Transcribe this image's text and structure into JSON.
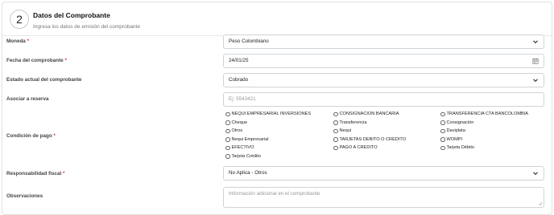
{
  "section": {
    "step": "2",
    "title": "Datos del Comprobante",
    "subtitle": "Ingresa los datos de emisión del comprobante"
  },
  "fields": {
    "moneda": {
      "label": "Moneda",
      "required": "*",
      "value": "Peso Colombiano",
      "icon": "chevron-down-icon"
    },
    "fecha": {
      "label": "Fecha del comprobante",
      "required": "*",
      "value": "24/01/25",
      "icon": "calendar-icon"
    },
    "estado": {
      "label": "Estado actual del comprobante",
      "value": "Cobrado",
      "icon": "chevron-down-icon"
    },
    "reserva": {
      "label": "Asociar a reserva",
      "placeholder": "Ej: 5543421"
    },
    "condicion": {
      "label": "Condición de pago",
      "required": "*",
      "options": [
        "NEQUI EMPRESARIAL INVERSIONES",
        "CONSIGNACION BANCARIA",
        "TRANSFERENCIA CTA BANCOLOMBIA",
        "Cheque",
        "Transferencia",
        "Consignación",
        "Otros",
        "Nequi",
        "Daviplata",
        "Nequi Empresarial",
        "TARJETAS DEBITO O CREDITO",
        "WOMPI",
        "EFECTIVO",
        "PAGO A CREDITO",
        "Tarjeta Débito",
        "Tarjeta Crédito"
      ]
    },
    "responsabilidad": {
      "label": "Responsabilidad fiscal",
      "required": "*",
      "value": "No Aplica - Otros",
      "icon": "chevron-down-icon"
    },
    "observaciones": {
      "label": "Observaciones",
      "placeholder": "Información adicional en el comprobante"
    }
  }
}
